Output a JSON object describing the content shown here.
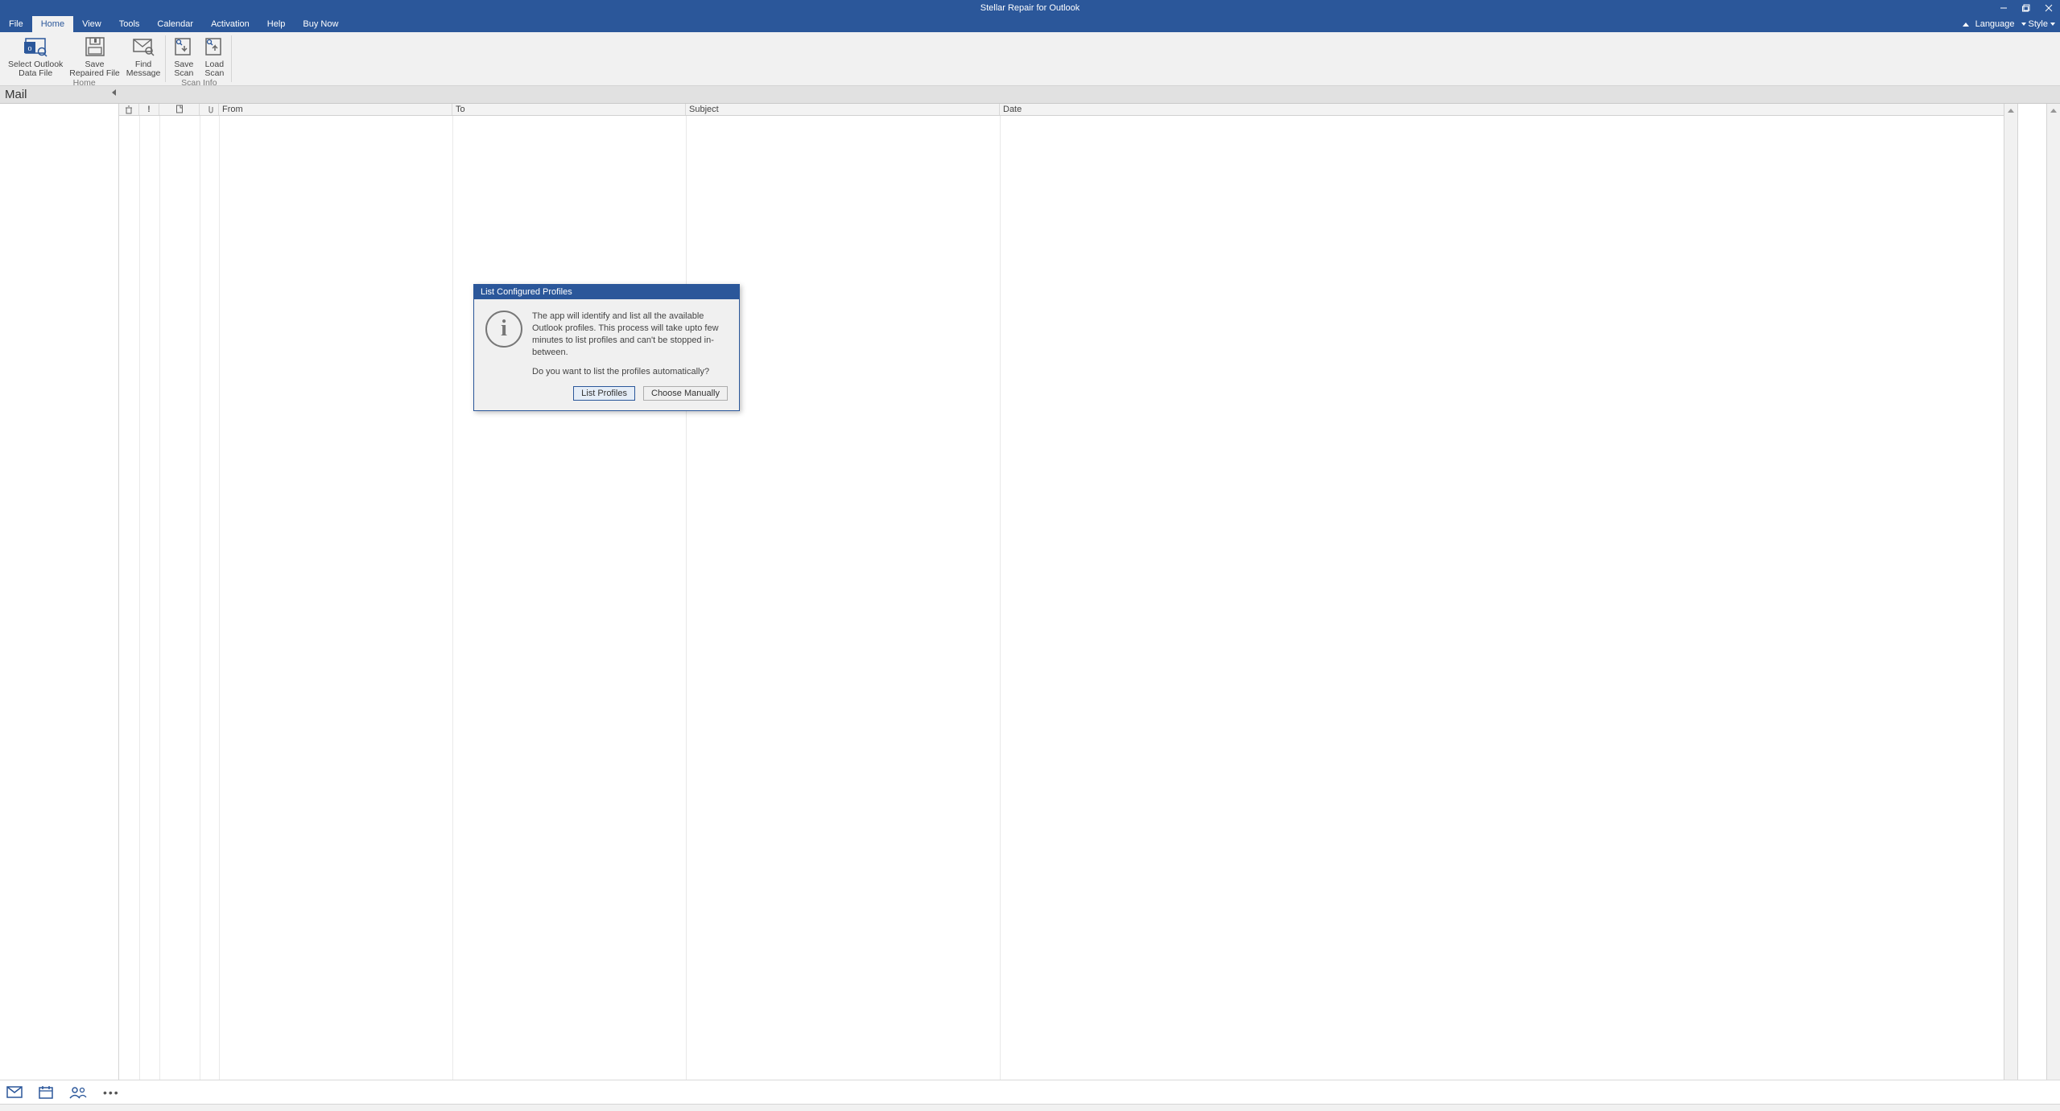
{
  "app": {
    "title": "Stellar Repair for Outlook"
  },
  "window_controls": {
    "min": "min",
    "max": "max",
    "close": "close"
  },
  "menu": {
    "tabs": [
      "File",
      "Home",
      "View",
      "Tools",
      "Calendar",
      "Activation",
      "Help",
      "Buy Now"
    ],
    "active_index": 1,
    "right": {
      "language": "Language",
      "style": "Style"
    }
  },
  "ribbon": {
    "groups": [
      {
        "title": "Home",
        "items": [
          {
            "label_line1": "Select Outlook",
            "label_line2": "Data File",
            "name": "select-outlook-data-file"
          },
          {
            "label_line1": "Save",
            "label_line2": "Repaired File",
            "name": "save-repaired-file"
          },
          {
            "label_line1": "Find",
            "label_line2": "Message",
            "name": "find-message"
          }
        ]
      },
      {
        "title": "Scan Info",
        "items": [
          {
            "label_line1": "Save",
            "label_line2": "Scan",
            "name": "save-scan"
          },
          {
            "label_line1": "Load",
            "label_line2": "Scan",
            "name": "load-scan"
          }
        ]
      }
    ]
  },
  "panes": {
    "left_title": "Mail"
  },
  "columns": {
    "from": "From",
    "to": "To",
    "subject": "Subject",
    "date": "Date"
  },
  "bottom_nav": {
    "mail": "mail",
    "calendar": "calendar",
    "contacts": "contacts",
    "more": "•••"
  },
  "dialog": {
    "title": "List Configured Profiles",
    "message1": "The app will identify and list all the available Outlook profiles. This process will take upto few minutes to list profiles and can't be stopped in-between.",
    "message2": "Do you want to list the profiles automatically?",
    "primary_button": "List Profiles",
    "secondary_button": "Choose Manually"
  }
}
